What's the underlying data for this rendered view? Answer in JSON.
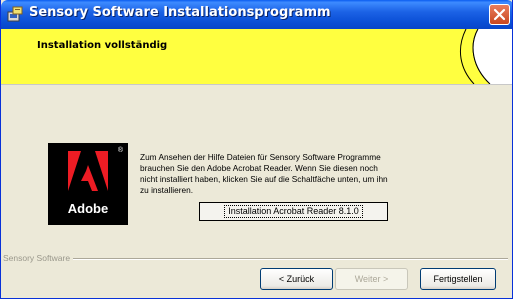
{
  "window": {
    "title": "Sensory Software Installationsprogramm",
    "colors": {
      "titlebar": "#0a5cf0",
      "header_band": "#ffff40",
      "close": "#e06a44"
    }
  },
  "header": {
    "title": "Installation vollständig"
  },
  "logo": {
    "text": "Adobe",
    "reg": "®"
  },
  "info": {
    "lines": [
      "Zum Ansehen der Hilfe Dateien für Sensory Software Programme",
      "brauchen Sie den Adobe Acrobat Reader. Wenn Sie diesen noch",
      "nicht installiert haben, klicken Sie auf die Schaltfäche unten, um ihn",
      "zu installieren."
    ]
  },
  "install_button": {
    "label": "Installation Acrobat Reader 8.1.0"
  },
  "brand": {
    "label": "Sensory Software"
  },
  "buttons": {
    "back": "< Zurück",
    "next": "Weiter >",
    "finish": "Fertigstellen"
  },
  "icons": {
    "app": "installer-icon",
    "close": "close-icon"
  }
}
